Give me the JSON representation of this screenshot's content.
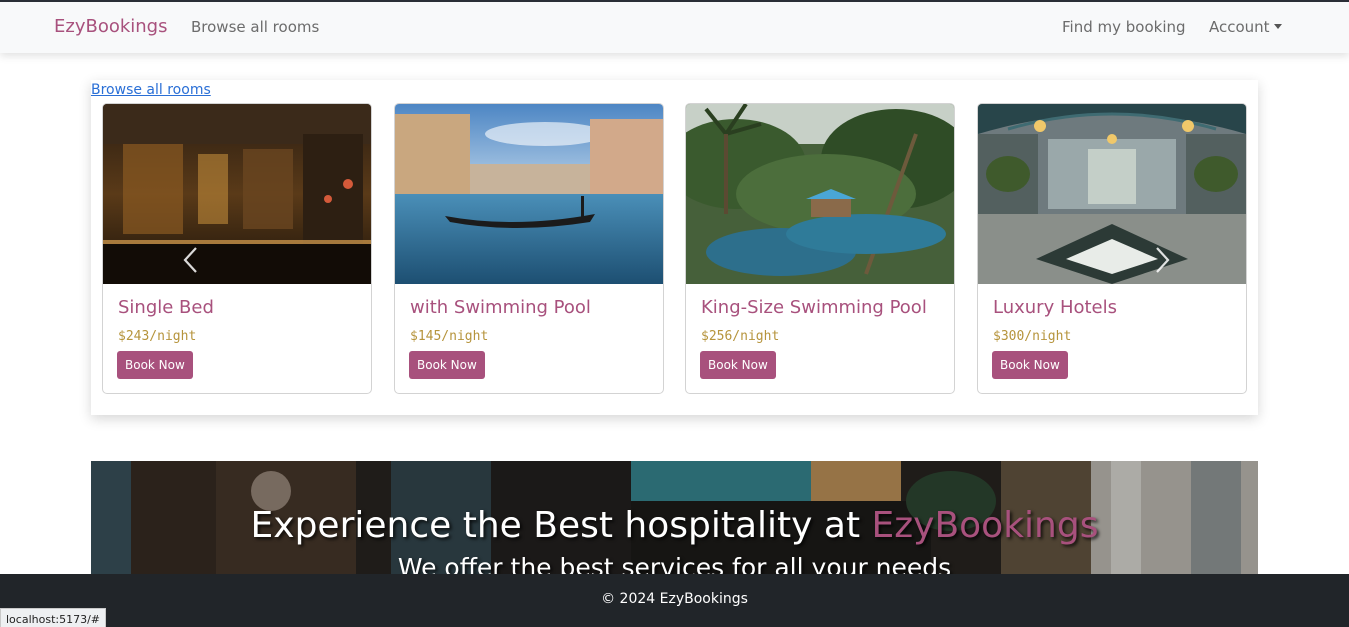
{
  "navbar": {
    "brand": "EzyBookings",
    "browse_link": "Browse all rooms",
    "find_link": "Find my booking",
    "account_label": "Account"
  },
  "carousel": {
    "browse_link": "Browse all rooms",
    "prev_icon": "chevron-left-icon",
    "next_icon": "chevron-right-icon",
    "rooms": [
      {
        "title": "Single Bed",
        "price": "$243/night",
        "button": "Book Now"
      },
      {
        "title": "with Swimming Pool",
        "price": "$145/night",
        "button": "Book Now"
      },
      {
        "title": "King-Size Swimming Pool",
        "price": "$256/night",
        "button": "Book Now"
      },
      {
        "title": "Luxury Hotels",
        "price": "$300/night",
        "button": "Book Now"
      }
    ]
  },
  "hero": {
    "title_prefix": "Experience the Best hospitality at ",
    "title_brand": "EzyBookings",
    "subtitle": "We offer the best services for all your needs"
  },
  "footer": {
    "text": "© 2024 EzyBookings"
  },
  "status_bar": {
    "url": "localhost:5173/#"
  },
  "colors": {
    "brand": "#a8517d",
    "price": "#b6943c",
    "footer_bg": "#212529",
    "navbar_bg": "#f8f9fa"
  }
}
